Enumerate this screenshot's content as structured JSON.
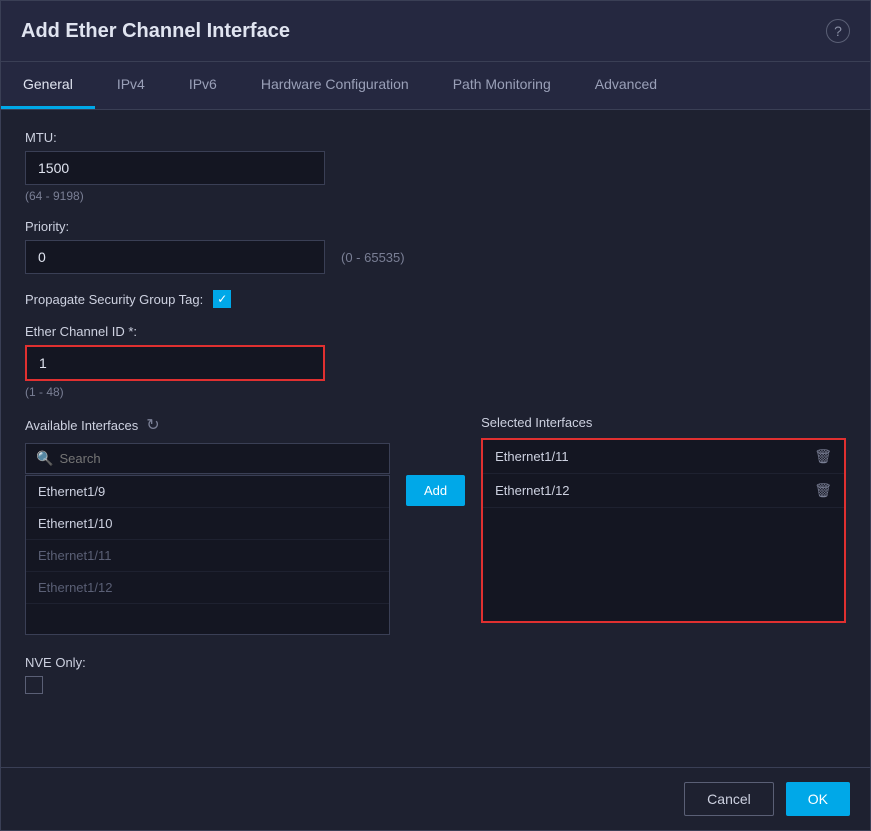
{
  "dialog": {
    "title": "Add Ether Channel Interface",
    "help_icon": "?"
  },
  "tabs": [
    {
      "label": "General",
      "active": true
    },
    {
      "label": "IPv4",
      "active": false
    },
    {
      "label": "IPv6",
      "active": false
    },
    {
      "label": "Hardware Configuration",
      "active": false
    },
    {
      "label": "Path Monitoring",
      "active": false
    },
    {
      "label": "Advanced",
      "active": false
    }
  ],
  "fields": {
    "mtu_label": "MTU:",
    "mtu_value": "1500",
    "mtu_hint": "(64 - 9198)",
    "priority_label": "Priority:",
    "priority_value": "0",
    "priority_hint": "(0 - 65535)",
    "propagate_label": "Propagate Security Group Tag:",
    "ether_channel_id_label": "Ether Channel ID *:",
    "ether_channel_id_value": "1",
    "ether_channel_id_hint": "(1 - 48)"
  },
  "available_interfaces": {
    "title": "Available Interfaces",
    "search_placeholder": "Search",
    "items": [
      {
        "name": "Ethernet1/9",
        "dimmed": false
      },
      {
        "name": "Ethernet1/10",
        "dimmed": false
      },
      {
        "name": "Ethernet1/11",
        "dimmed": true
      },
      {
        "name": "Ethernet1/12",
        "dimmed": true
      }
    ]
  },
  "selected_interfaces": {
    "title": "Selected Interfaces",
    "items": [
      {
        "name": "Ethernet1/11"
      },
      {
        "name": "Ethernet1/12"
      }
    ]
  },
  "buttons": {
    "add": "Add",
    "cancel": "Cancel",
    "ok": "OK"
  },
  "nve": {
    "label": "NVE Only:"
  }
}
